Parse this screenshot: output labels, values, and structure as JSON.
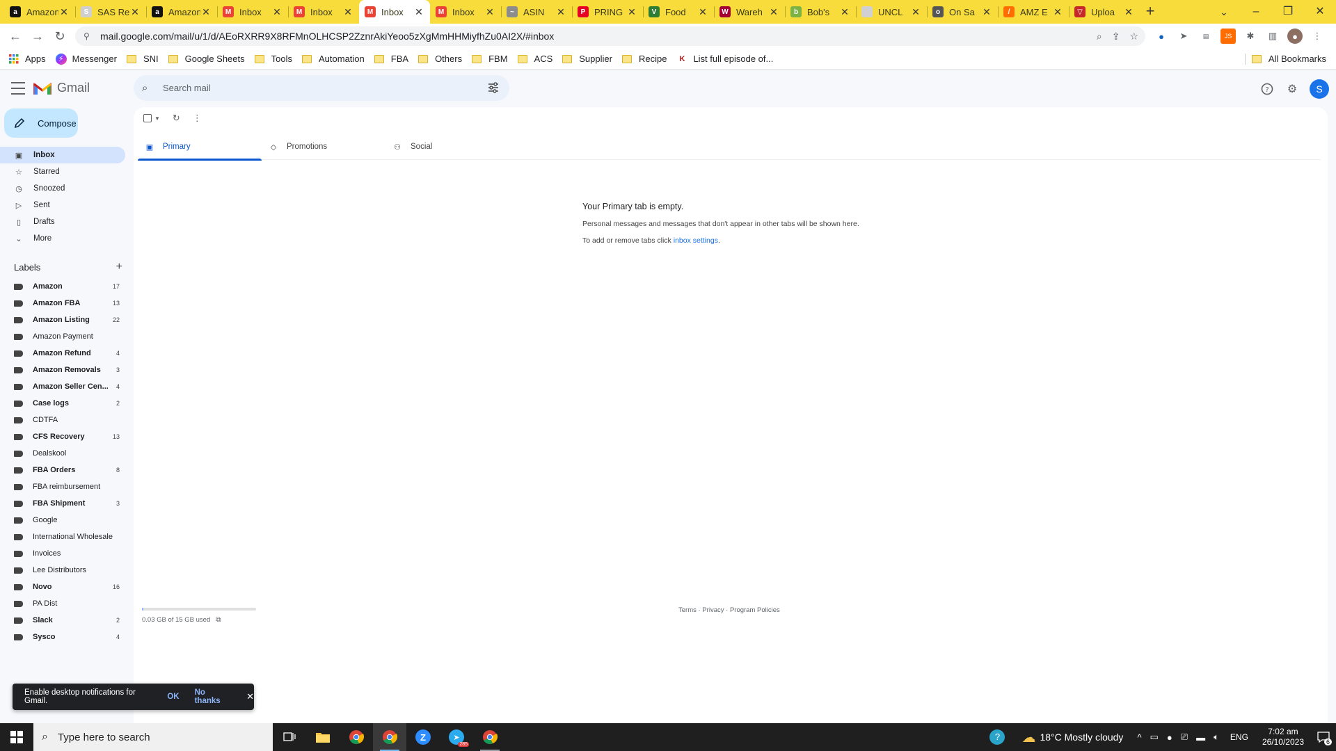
{
  "browser": {
    "tabs": [
      {
        "title": "Amazon",
        "icon": "amazon-icon",
        "color": "#111111",
        "glyph": "a"
      },
      {
        "title": "SAS Rem",
        "icon": "sas-icon",
        "color": "#cfcfcf",
        "glyph": "S"
      },
      {
        "title": "Amazon",
        "icon": "amazon-icon",
        "color": "#111111",
        "glyph": "a"
      },
      {
        "title": "Inbox",
        "icon": "gmail-icon",
        "color": "#ea4335",
        "glyph": "M"
      },
      {
        "title": "Inbox",
        "icon": "gmail-icon",
        "color": "#ea4335",
        "glyph": "M"
      },
      {
        "title": "Inbox",
        "icon": "gmail-icon",
        "color": "#ea4335",
        "glyph": "M"
      },
      {
        "title": "Inbox",
        "icon": "gmail-icon",
        "color": "#ea4335",
        "glyph": "M"
      },
      {
        "title": "ASIN",
        "icon": "asin-icon",
        "color": "#8c8c8c",
        "glyph": "~"
      },
      {
        "title": "PRING",
        "icon": "pinterest-icon",
        "color": "#e60023",
        "glyph": "P"
      },
      {
        "title": "Food",
        "icon": "food-icon",
        "color": "#2e7d32",
        "glyph": "V"
      },
      {
        "title": "Wareh",
        "icon": "warehouse-icon",
        "color": "#a50034",
        "glyph": "W"
      },
      {
        "title": "Bob's",
        "icon": "bobs-icon",
        "color": "#7cb342",
        "glyph": "b"
      },
      {
        "title": "UNCL",
        "icon": "document-icon",
        "color": "#d0d0d0",
        "glyph": ""
      },
      {
        "title": "On Sa",
        "icon": "globe-icon",
        "color": "#555555",
        "glyph": "o"
      },
      {
        "title": "AMZ E",
        "icon": "amz-icon",
        "color": "#ff6d00",
        "glyph": "/"
      },
      {
        "title": "Uploa",
        "icon": "upload-icon",
        "color": "#c62828",
        "glyph": "▽"
      }
    ],
    "active_tab": 5,
    "url": "mail.google.com/mail/u/1/d/AEoRXRR9X8RFMnOLHCSP2ZznrAkiYeoo5zXgMmHHMiyfhZu0AI2X/#inbox",
    "bookmarks": [
      {
        "label": "Apps",
        "type": "apps"
      },
      {
        "label": "Messenger",
        "type": "messenger"
      },
      {
        "label": "SNI",
        "type": "folder"
      },
      {
        "label": "Google Sheets",
        "type": "folder"
      },
      {
        "label": "Tools",
        "type": "folder"
      },
      {
        "label": "Automation",
        "type": "folder"
      },
      {
        "label": "FBA",
        "type": "folder"
      },
      {
        "label": "Others",
        "type": "folder"
      },
      {
        "label": "FBM",
        "type": "folder"
      },
      {
        "label": "ACS",
        "type": "folder"
      },
      {
        "label": "Supplier",
        "type": "folder"
      },
      {
        "label": "Recipe",
        "type": "folder"
      },
      {
        "label": "List full episode of...",
        "type": "kissanime"
      }
    ],
    "all_bookmarks": "All Bookmarks"
  },
  "gmail": {
    "logo_text": "Gmail",
    "search_placeholder": "Search mail",
    "avatar_letter": "S",
    "compose_label": "Compose",
    "nav": [
      {
        "label": "Inbox",
        "icon": "inbox-icon",
        "glyph": "▣",
        "active": true
      },
      {
        "label": "Starred",
        "icon": "star-icon",
        "glyph": "☆",
        "active": false
      },
      {
        "label": "Snoozed",
        "icon": "clock-icon",
        "glyph": "◷",
        "active": false
      },
      {
        "label": "Sent",
        "icon": "send-icon",
        "glyph": "▷",
        "active": false
      },
      {
        "label": "Drafts",
        "icon": "draft-icon",
        "glyph": "▯",
        "active": false
      },
      {
        "label": "More",
        "icon": "chevron-down-icon",
        "glyph": "⌄",
        "active": false
      }
    ],
    "labels_title": "Labels",
    "labels": [
      {
        "name": "Amazon",
        "count": "17",
        "bold": true
      },
      {
        "name": "Amazon FBA",
        "count": "13",
        "bold": true
      },
      {
        "name": "Amazon Listing",
        "count": "22",
        "bold": true
      },
      {
        "name": "Amazon Payment",
        "count": "",
        "bold": false
      },
      {
        "name": "Amazon Refund",
        "count": "4",
        "bold": true
      },
      {
        "name": "Amazon Removals",
        "count": "3",
        "bold": true
      },
      {
        "name": "Amazon Seller Cen...",
        "count": "4",
        "bold": true
      },
      {
        "name": "Case logs",
        "count": "2",
        "bold": true
      },
      {
        "name": "CDTFA",
        "count": "",
        "bold": false
      },
      {
        "name": "CFS Recovery",
        "count": "13",
        "bold": true
      },
      {
        "name": "Dealskool",
        "count": "",
        "bold": false
      },
      {
        "name": "FBA Orders",
        "count": "8",
        "bold": true
      },
      {
        "name": "FBA reimbursement",
        "count": "",
        "bold": false
      },
      {
        "name": "FBA Shipment",
        "count": "3",
        "bold": true
      },
      {
        "name": "Google",
        "count": "",
        "bold": false
      },
      {
        "name": "International Wholesale",
        "count": "",
        "bold": false
      },
      {
        "name": "Invoices",
        "count": "",
        "bold": false
      },
      {
        "name": "Lee Distributors",
        "count": "",
        "bold": false
      },
      {
        "name": "Novo",
        "count": "16",
        "bold": true
      },
      {
        "name": "PA Dist",
        "count": "",
        "bold": false
      },
      {
        "name": "Slack",
        "count": "2",
        "bold": true
      },
      {
        "name": "Sysco",
        "count": "4",
        "bold": true
      }
    ],
    "tabs": [
      {
        "label": "Primary",
        "icon": "inbox-icon",
        "glyph": "▣",
        "active": true
      },
      {
        "label": "Promotions",
        "icon": "tag-icon",
        "glyph": "◇",
        "active": false
      },
      {
        "label": "Social",
        "icon": "people-icon",
        "glyph": "⚇",
        "active": false
      }
    ],
    "empty": {
      "heading": "Your Primary tab is empty.",
      "line1": "Personal messages and messages that don't appear in other tabs will be shown here.",
      "line2_prefix": "To add or remove tabs click ",
      "line2_link": "inbox settings",
      "line2_suffix": "."
    },
    "storage": {
      "text": "0.03 GB of 15 GB used",
      "fraction": 0.002
    },
    "footer": {
      "terms": "Terms",
      "privacy": "Privacy",
      "policies": "Program Policies",
      "sep": " · "
    },
    "toast": {
      "message": "Enable desktop notifications for Gmail.",
      "ok": "OK",
      "no_thanks": "No thanks"
    }
  },
  "taskbar": {
    "search_placeholder": "Type here to search",
    "weather": "18°C  Mostly cloudy",
    "language": "ENG",
    "time": "7:02 am",
    "date": "26/10/2023",
    "notification_count": "6",
    "telegram_badge": "285"
  },
  "colors": {
    "tabstrip": "#f7dc3c",
    "compose": "#c2e7ff",
    "active_nav": "#d3e3fd",
    "accent": "#0b57d0"
  }
}
